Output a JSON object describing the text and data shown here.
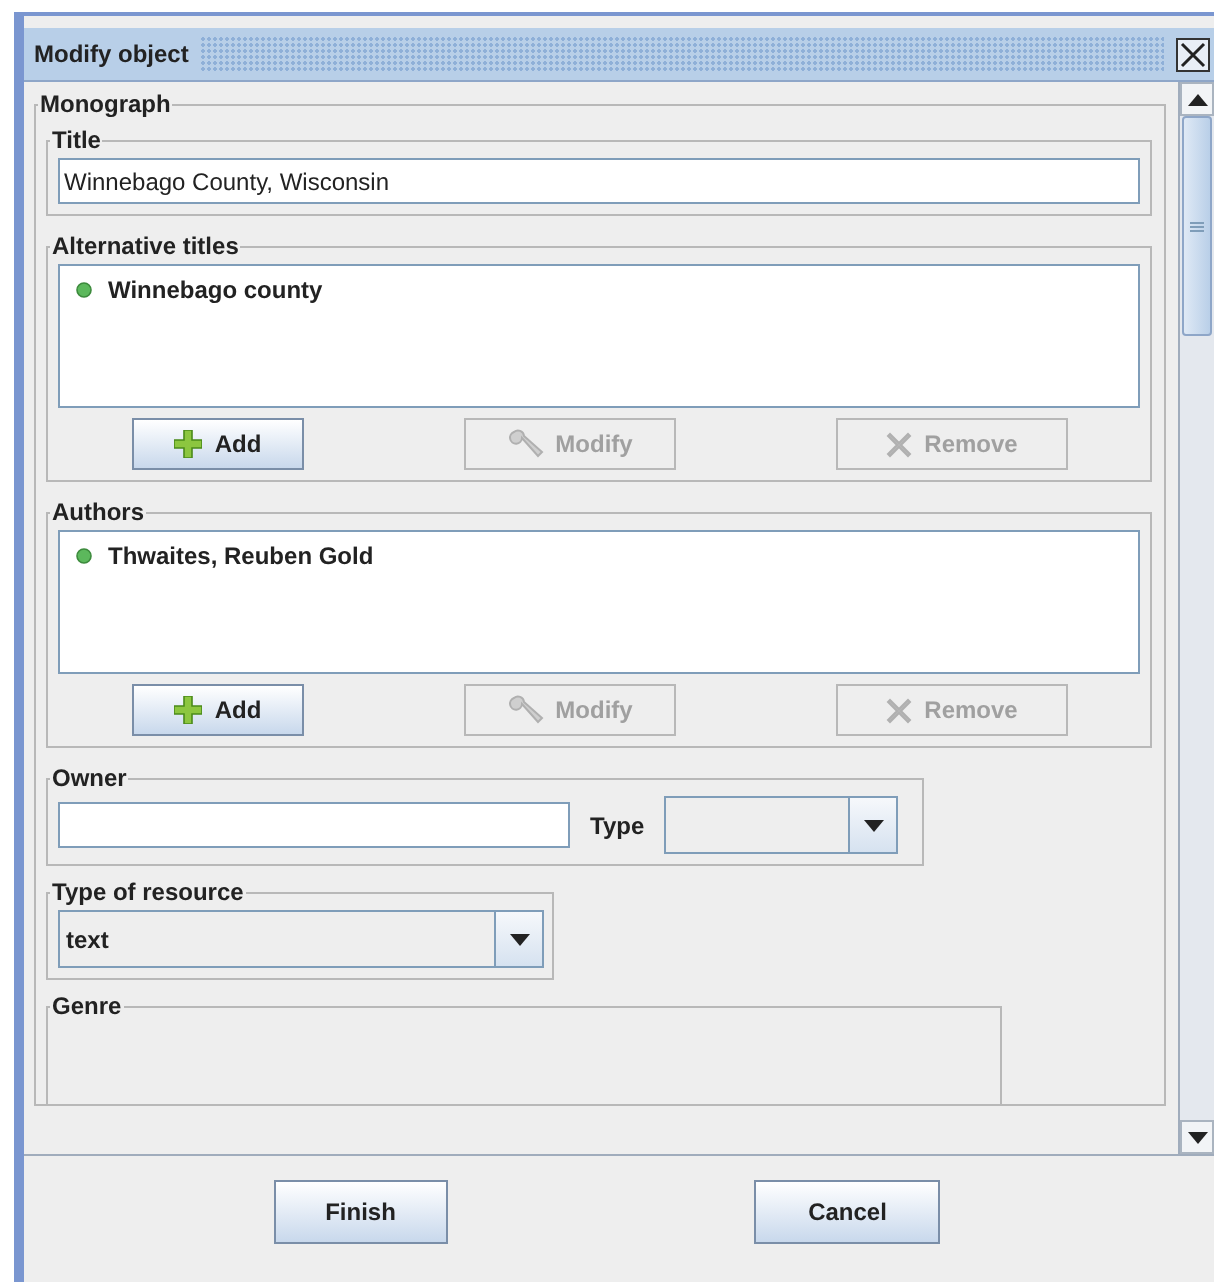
{
  "window": {
    "title": "Modify object"
  },
  "monograph": {
    "label": "Monograph",
    "title": {
      "label": "Title",
      "value": "Winnebago County, Wisconsin"
    },
    "lists": [
      {
        "label": "Alternative titles",
        "items": [
          "Winnebago county"
        ],
        "buttons": [
          {
            "kind": "add",
            "label": "Add",
            "disabled": false
          },
          {
            "kind": "modify",
            "label": "Modify",
            "disabled": true
          },
          {
            "kind": "remove",
            "label": "Remove",
            "disabled": true
          }
        ]
      },
      {
        "label": "Authors",
        "items": [
          "Thwaites, Reuben Gold"
        ],
        "buttons": [
          {
            "kind": "add",
            "label": "Add",
            "disabled": false
          },
          {
            "kind": "modify",
            "label": "Modify",
            "disabled": true
          },
          {
            "kind": "remove",
            "label": "Remove",
            "disabled": true
          }
        ]
      }
    ],
    "owner": {
      "label": "Owner",
      "type_label": "Type"
    },
    "type_of_resource": {
      "label": "Type of resource",
      "value": "text"
    },
    "genre": {
      "label": "Genre"
    }
  },
  "buttons": [
    "Finish",
    "Cancel"
  ]
}
